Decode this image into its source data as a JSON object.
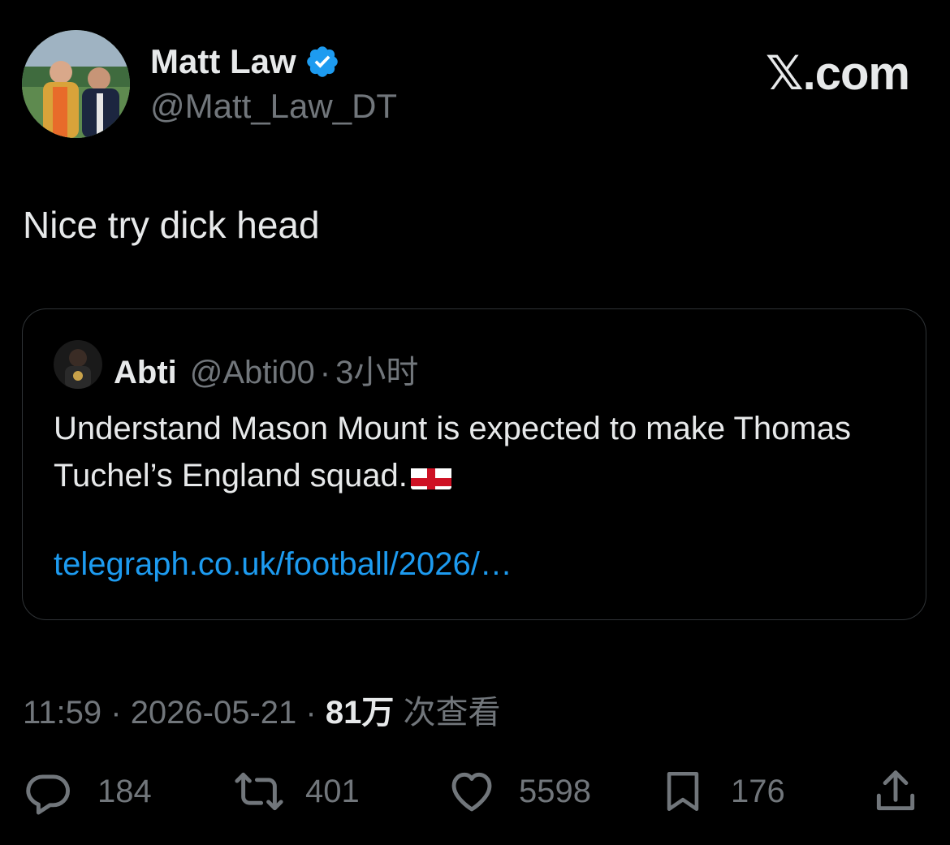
{
  "author": {
    "display_name": "Matt Law",
    "handle": "@Matt_Law_DT",
    "verified_icon": "verified-badge-icon",
    "avatar_icon": "avatar-photo"
  },
  "brand": {
    "x_glyph": "𝕏",
    "suffix": ".com"
  },
  "tweet": {
    "text": "Nice try dick head"
  },
  "quote": {
    "display_name": "Abti",
    "handle": "@Abti00",
    "separator": "·",
    "time": "3小时",
    "text": "Understand Mason Mount is expected to make Thomas Tuchel’s England squad.",
    "flag_icon": "england-flag-icon",
    "link": "telegraph.co.uk/football/2026/…"
  },
  "meta": {
    "time": "11:59",
    "sep1": " · ",
    "date": "2026-05-21",
    "sep2": " · ",
    "views": "81万",
    "views_label": " 次查看"
  },
  "actions": {
    "replies": "184",
    "reposts": "401",
    "likes": "5598",
    "bookmarks": "176"
  },
  "colors": {
    "background": "#000000",
    "primary_text": "#e7e9ea",
    "secondary_text": "#71767b",
    "link": "#1d9bf0",
    "verified": "#1d9bf0",
    "border": "#2f3336"
  }
}
